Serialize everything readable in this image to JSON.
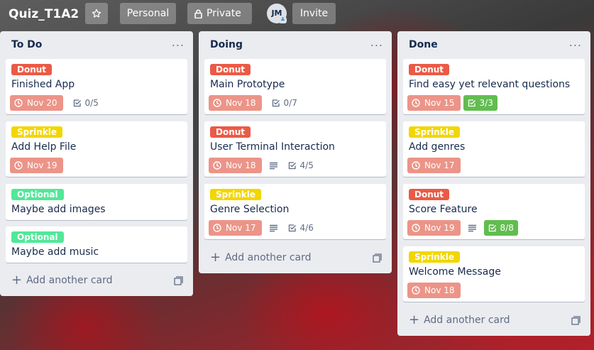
{
  "board": {
    "title": "Quiz_T1A2",
    "visibility_team": "Personal",
    "visibility_privacy": "Private",
    "member_initials": "JM",
    "invite_label": "Invite"
  },
  "colors": {
    "donut": "#eb5a46",
    "sprinkle": "#f2d600",
    "optional": "#51e898",
    "due": "#ec9488",
    "checklist_complete": "#61bd4f"
  },
  "lists": [
    {
      "title": "To Do",
      "menu": "...",
      "add_label": "Add another card",
      "cards": [
        {
          "label": "Donut",
          "title": "Finished App",
          "due": "Nov 20",
          "checklist": "0/5"
        },
        {
          "label": "Sprinkle",
          "title": "Add Help File",
          "due": "Nov 19"
        },
        {
          "label": "Optional",
          "title": "Maybe add images"
        },
        {
          "label": "Optional",
          "title": "Maybe add music"
        }
      ]
    },
    {
      "title": "Doing",
      "menu": "...",
      "add_label": "Add another card",
      "cards": [
        {
          "label": "Donut",
          "title": "Main Prototype",
          "due": "Nov 18",
          "checklist": "0/7"
        },
        {
          "label": "Donut",
          "title": "User Terminal Interaction",
          "due": "Nov 18",
          "description": true,
          "checklist": "4/5"
        },
        {
          "label": "Sprinkle",
          "title": "Genre Selection",
          "due": "Nov 17",
          "description": true,
          "checklist": "4/6"
        }
      ]
    },
    {
      "title": "Done",
      "menu": "...",
      "add_label": "Add another card",
      "cards": [
        {
          "label": "Donut",
          "title": "Find easy yet relevant questions",
          "due": "Nov 15",
          "checklist": "3/3",
          "checklist_complete": true
        },
        {
          "label": "Sprinkle",
          "title": "Add genres",
          "due": "Nov 17"
        },
        {
          "label": "Donut",
          "title": "Score Feature",
          "due": "Nov 19",
          "description": true,
          "checklist": "8/8",
          "checklist_complete": true
        },
        {
          "label": "Sprinkle",
          "title": "Welcome Message",
          "due": "Nov 18"
        }
      ]
    }
  ]
}
